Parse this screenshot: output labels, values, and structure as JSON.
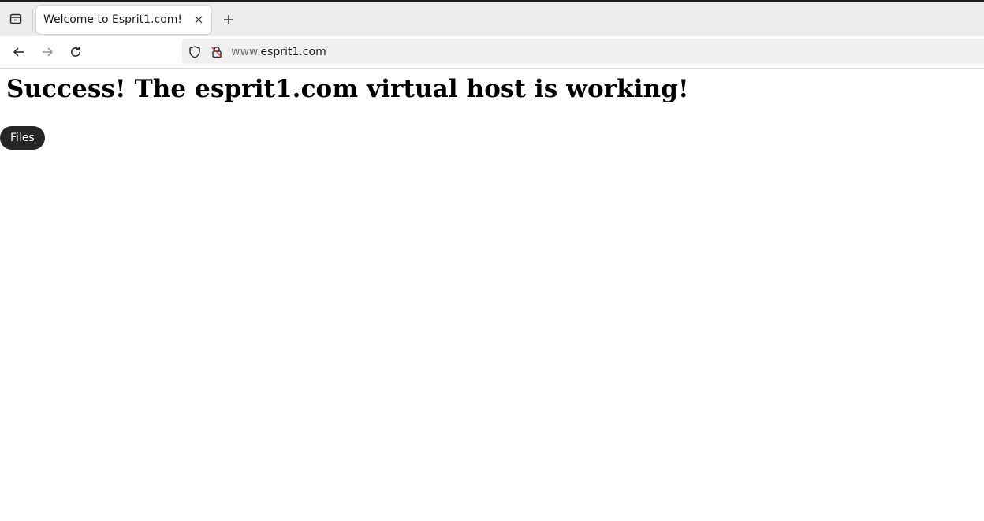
{
  "browser": {
    "tab": {
      "title": "Welcome to Esprit1.com!",
      "close_icon": "close-icon"
    },
    "new_tab_icon": "plus-icon",
    "tab_overview_icon": "tab-overview-icon",
    "nav": {
      "back_icon": "arrow-left-icon",
      "forward_icon": "arrow-right-icon",
      "reload_icon": "reload-icon"
    },
    "url": {
      "prefix": "www.",
      "domain": "esprit1.com",
      "shield_icon": "shield-icon",
      "lock_icon": "insecure-lock-icon"
    }
  },
  "page": {
    "heading": "Success! The esprit1.com virtual host is working!",
    "files_button_label": "Files"
  },
  "colors": {
    "tabbar_bg": "#ececec",
    "urlbar_bg": "#f0f0f3",
    "button_bg": "#262626",
    "button_text": "#ffffff"
  }
}
